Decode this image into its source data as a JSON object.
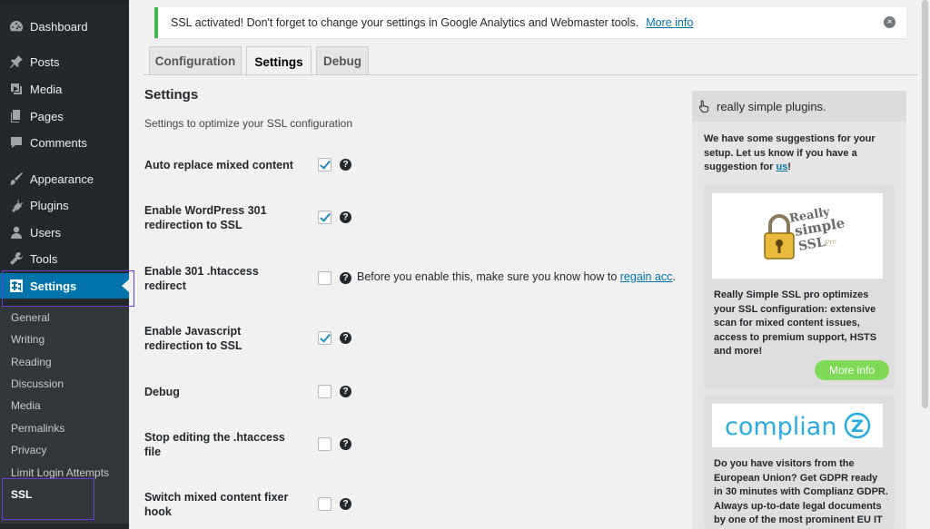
{
  "sidebar": {
    "menu": [
      {
        "label": "Dashboard",
        "icon": "dashboard-icon"
      },
      {
        "label": "Posts",
        "icon": "pin-icon"
      },
      {
        "label": "Media",
        "icon": "media-icon"
      },
      {
        "label": "Pages",
        "icon": "pages-icon"
      },
      {
        "label": "Comments",
        "icon": "comment-icon"
      },
      {
        "label": "Appearance",
        "icon": "brush-icon"
      },
      {
        "label": "Plugins",
        "icon": "plug-icon"
      },
      {
        "label": "Users",
        "icon": "user-icon"
      },
      {
        "label": "Tools",
        "icon": "wrench-icon"
      },
      {
        "label": "Settings",
        "icon": "settings-icon"
      }
    ],
    "submenu": [
      "General",
      "Writing",
      "Reading",
      "Discussion",
      "Media",
      "Permalinks",
      "Privacy",
      "Limit Login Attempts",
      "SSL"
    ]
  },
  "notice": {
    "text": "SSL activated!  Don't forget to change your settings in Google Analytics and Webmaster tools.",
    "link": "More info",
    "close": "×"
  },
  "tabs": [
    "Configuration",
    "Settings",
    "Debug"
  ],
  "settings": {
    "title": "Settings",
    "description": "Settings to optimize your SSL configuration",
    "help_glyph": "?",
    "rows": [
      {
        "label": "Auto replace mixed content",
        "checked": true
      },
      {
        "label": "Enable WordPress 301 redirection to SSL",
        "checked": true
      },
      {
        "label": "Enable 301 .htaccess redirect",
        "checked": false,
        "note": "Before you enable this, make sure you know how to ",
        "note_link": "regain acc"
      },
      {
        "label": "Enable Javascript redirection to SSL",
        "checked": true
      },
      {
        "label": "Debug",
        "checked": false
      },
      {
        "label": "Stop editing the .htaccess file",
        "checked": false
      },
      {
        "label": "Switch mixed content fixer hook",
        "checked": false
      }
    ]
  },
  "panel": {
    "header": "really simple plugins.",
    "intro": "We have some suggestions for your setup. Let us know if you have a suggestion for ",
    "intro_link": "us",
    "intro_end": "!",
    "card1": {
      "logo_line1": "Really",
      "logo_line2": "simple",
      "logo_line3": "SSL",
      "logo_pro": "Pro",
      "text": "Really Simple SSL pro optimizes your SSL configuration: extensive scan for mixed content issues, access to premium support, HSTS and more!",
      "button": "More info"
    },
    "card2": {
      "logo": "complian",
      "logo_z": "Z",
      "text": "Do you have visitors from the European Union? Get GDPR ready in 30 minutes with Complianz GDPR. Always up-to-date legal documents by one of the most prominent EU IT"
    }
  },
  "colors": {
    "sidebar_bg": "#23282d",
    "active_blue": "#0073aa",
    "notice_green": "#46b450",
    "highlight_purple": "#6a3fd6",
    "more_info_green": "#7ed957",
    "complianz_blue": "#29abe2"
  }
}
